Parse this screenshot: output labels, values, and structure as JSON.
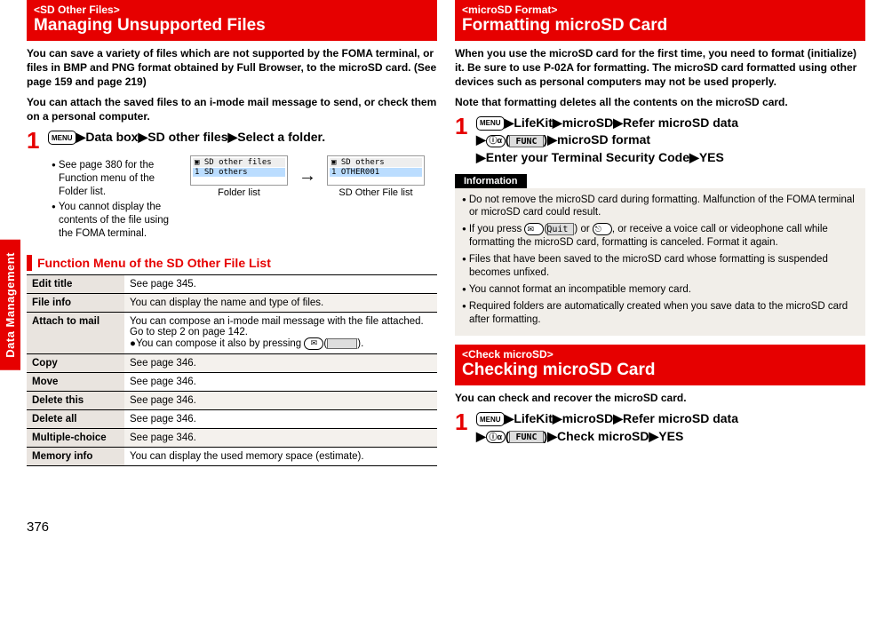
{
  "sideTab": "Data Management",
  "pageNumber": "376",
  "left": {
    "headerSub": "<SD Other Files>",
    "headerTitle": "Managing Unsupported Files",
    "intro1": "You can save a variety of files which are not supported by the FOMA terminal, or files in BMP and PNG format obtained by Full Browser, to the microSD card. (See page 159 and page 219)",
    "intro2": "You can attach the saved files to an i-mode mail message to send, or check them on a personal computer.",
    "stepNum": "1",
    "menuIcon": "MENU",
    "stepPart1": "Data box",
    "stepPart2": "SD other files",
    "stepPart3": "Select a folder.",
    "bullet1": "See page 380 for the Function menu of the Folder list.",
    "bullet2": "You cannot display the contents of the file using the FOMA terminal.",
    "screen1title": "SD other files",
    "screen1row": "1 SD others",
    "screen1cap": "Folder list",
    "screen2title": "SD others",
    "screen2row": "1 OTHER001",
    "screen2cap": "SD Other File list",
    "funcMenuTitle": "Function Menu of the SD Other File List",
    "menuItems": [
      {
        "k": "Edit title",
        "v": "See page 345."
      },
      {
        "k": "File info",
        "v": "You can display the name and type of files."
      },
      {
        "k": "Attach to mail",
        "v": "You can compose an i-mode mail message with the file attached. Go to step 2 on page 142.",
        "extra": "You can compose it also by pressing ",
        "extraIcon1": "✉",
        "extraIcon2": "blank",
        "extraEnd": ")."
      },
      {
        "k": "Copy",
        "v": "See page 346."
      },
      {
        "k": "Move",
        "v": "See page 346."
      },
      {
        "k": "Delete this",
        "v": "See page 346."
      },
      {
        "k": "Delete all",
        "v": "See page 346."
      },
      {
        "k": "Multiple-choice",
        "v": "See page 346."
      },
      {
        "k": "Memory info",
        "v": "You can display the used memory space (estimate)."
      }
    ]
  },
  "rightA": {
    "headerSub": "<microSD Format>",
    "headerTitle": "Formatting microSD Card",
    "intro1": "When you use the microSD card for the first time, you need to format (initialize) it. Be sure to use P-02A for formatting. The microSD card formatted using other devices such as personal computers may not be used properly.",
    "intro2": "Note that formatting deletes all the contents on the microSD card.",
    "stepNum": "1",
    "menuIcon": "MENU",
    "p1": "LifeKit",
    "p2": "microSD",
    "p3": "Refer microSD data",
    "iIcon": "i",
    "funcLabel": "FUNC",
    "p4": "microSD format",
    "p5": "Enter your Terminal Security Code",
    "p6": "YES",
    "infoHeader": "Information",
    "infoBullets": [
      "Do not remove the microSD card during formatting. Malfunction of the FOMA terminal or microSD card could result.",
      "If you press ✉(Quit) or ⬯, or receive a voice call or videophone call while formatting the microSD card, formatting is canceled. Format it again.",
      "Files that have been saved to the microSD card whose formatting is suspended becomes unfixed.",
      "You cannot format an incompatible memory card.",
      "Required folders are automatically created when you save data to the microSD card after formatting."
    ]
  },
  "rightB": {
    "headerSub": "<Check microSD>",
    "headerTitle": "Checking microSD Card",
    "intro": "You can check and recover the microSD card.",
    "stepNum": "1",
    "menuIcon": "MENU",
    "p1": "LifeKit",
    "p2": "microSD",
    "p3": "Refer microSD data",
    "iIcon": "i",
    "funcLabel": "FUNC",
    "p4": "Check microSD",
    "p5": "YES"
  }
}
